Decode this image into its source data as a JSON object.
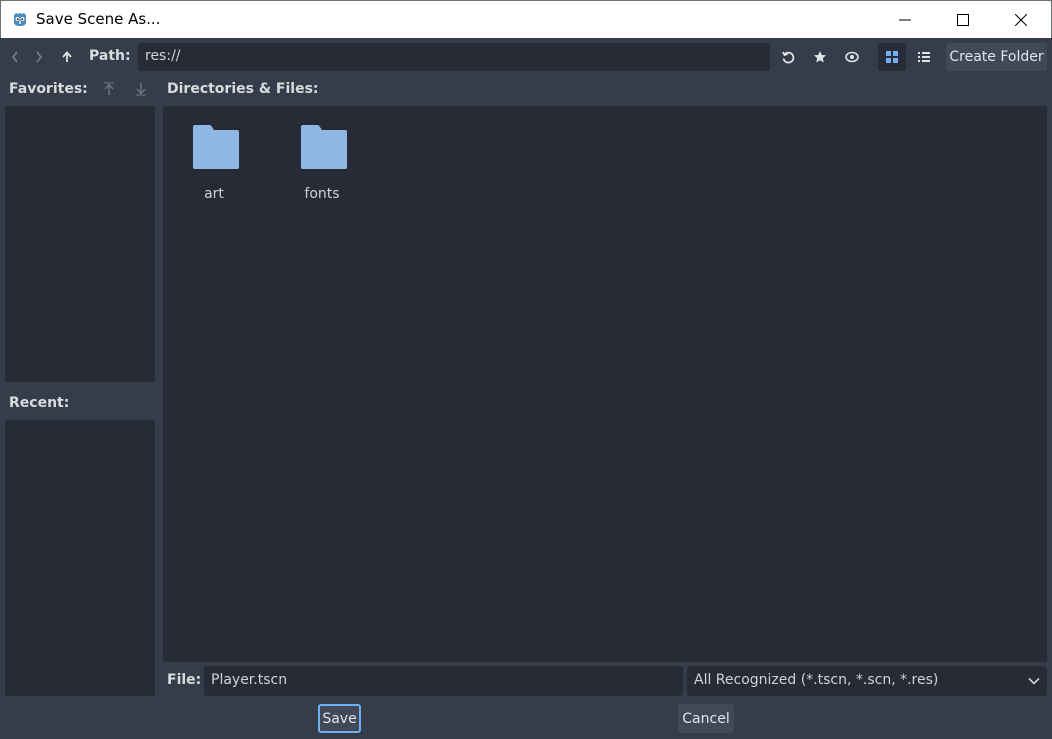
{
  "window": {
    "title": "Save Scene As..."
  },
  "toolbar": {
    "path_label": "Path:",
    "path_value": "res://",
    "create_folder_label": "Create Folder"
  },
  "sidebar": {
    "favorites_label": "Favorites:",
    "recent_label": "Recent:"
  },
  "files": {
    "header_label": "Directories & Files:",
    "items": [
      {
        "name": "art",
        "type": "folder"
      },
      {
        "name": "fonts",
        "type": "folder"
      }
    ]
  },
  "footer": {
    "file_label": "File:",
    "file_value": "Player.tscn",
    "filter_value": "All Recognized (*.tscn, *.scn, *.res)",
    "save_label": "Save",
    "cancel_label": "Cancel"
  },
  "colors": {
    "accent": "#6fb0f2",
    "folder": "#8eb8e3",
    "panel_bg": "#262b35",
    "window_bg": "#363d4a"
  },
  "icons": {
    "app": "godot-logo-icon",
    "back": "chevron-left-icon",
    "forward": "chevron-right-icon",
    "up": "arrow-up-icon",
    "refresh": "refresh-icon",
    "favorite": "star-icon",
    "hidden": "eye-icon",
    "grid_view": "grid-view-icon",
    "list_view": "list-view-icon"
  }
}
